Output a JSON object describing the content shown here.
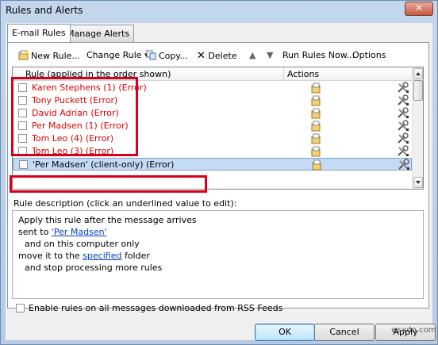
{
  "window": {
    "title": "Rules and Alerts",
    "close_glyph": "✕"
  },
  "tabs": [
    {
      "label": "E-mail Rules"
    },
    {
      "label": "Manage Alerts"
    }
  ],
  "toolbar": {
    "new_rule": "New Rule...",
    "change_rule": "Change Rule",
    "copy": "Copy...",
    "delete": "Delete",
    "run_rules_now": "Run Rules Now...",
    "options": "Options"
  },
  "grid": {
    "col_rule": "Rule (applied in the order shown)",
    "col_actions": "Actions",
    "rows": [
      {
        "name": "Karen Stephens (1)",
        "status": "(Error)",
        "selected": false
      },
      {
        "name": "Tony Puckett",
        "status": "(Error)",
        "selected": false
      },
      {
        "name": "David Adrian",
        "status": "(Error)",
        "selected": false
      },
      {
        "name": "Per Madsen (1)",
        "status": "(Error)",
        "selected": false
      },
      {
        "name": "Tom Leo (4)",
        "status": "(Error)",
        "selected": false
      },
      {
        "name": "Tom Leo (3)",
        "status": "(Error)",
        "selected": false
      },
      {
        "name": "'Per Madsen'  (client-only)",
        "status": "(Error)",
        "selected": true
      }
    ]
  },
  "description": {
    "label": "Rule description (click an underlined value to edit):",
    "line1": "Apply this rule after the message arrives",
    "line2_prefix": "sent to ",
    "line2_link": "'Per Madsen'",
    "line3": "and on this computer only",
    "line4_prefix": "move it to the ",
    "line4_link": "specified",
    "line4_suffix": " folder",
    "line5": "and stop processing more rules"
  },
  "rss_checkbox": {
    "label": "Enable rules on all messages downloaded from RSS Feeds",
    "checked": false
  },
  "buttons": {
    "ok": "OK",
    "cancel": "Cancel",
    "apply": "Apply"
  },
  "watermark": "wsxdn.com",
  "colors": {
    "error_text": "#e00000",
    "highlight_box": "#d6001c",
    "link": "#0040c0",
    "selected_row": "#c5daf5"
  }
}
